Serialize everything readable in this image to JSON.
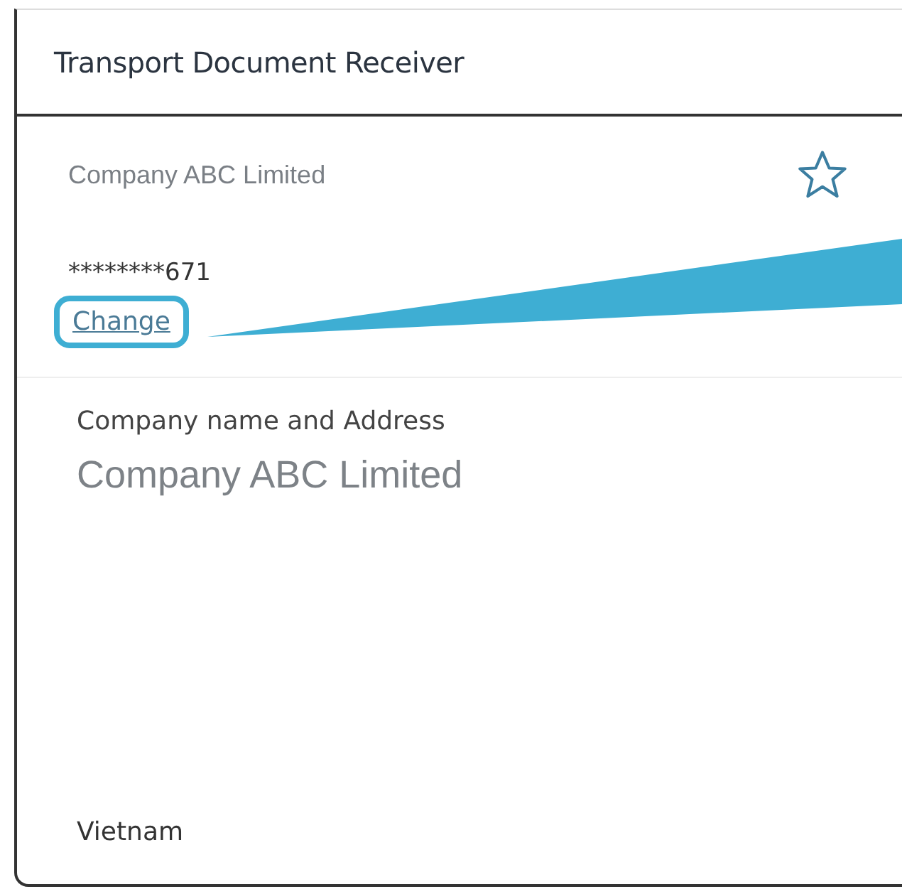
{
  "panel": {
    "title": "Transport Document Receiver"
  },
  "receiver": {
    "name": "Company ABC Limited",
    "favorite": false,
    "account": "********671",
    "change_link": "Change",
    "highlighted": true
  },
  "address": {
    "label": "Company name and Address",
    "name": "Company ABC Limited",
    "country": "Vietnam"
  }
}
